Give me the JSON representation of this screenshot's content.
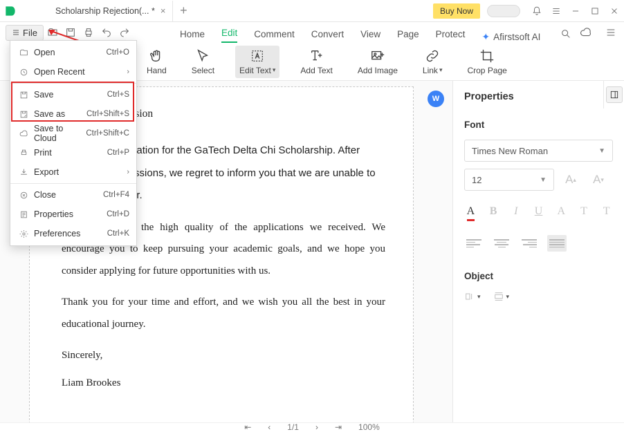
{
  "titlebar": {
    "tab_title": "Scholarship Rejection(... *",
    "buy_now": "Buy Now"
  },
  "file_chip": "File",
  "menu_tabs": [
    "Home",
    "Edit",
    "Comment",
    "Convert",
    "View",
    "Page",
    "Protect"
  ],
  "menu_tabs_active_index": 1,
  "ai_label": "Afirstsoft AI",
  "ribbon": {
    "hand": "Hand",
    "select": "Select",
    "edit_text": "Edit Text",
    "add_text": "Add Text",
    "add_image": "Add Image",
    "link": "Link",
    "crop_page": "Crop Page"
  },
  "file_menu": {
    "open": {
      "label": "Open",
      "shortcut": "Ctrl+O"
    },
    "open_recent": {
      "label": "Open Recent"
    },
    "save": {
      "label": "Save",
      "shortcut": "Ctrl+S"
    },
    "save_as": {
      "label": "Save as",
      "shortcut": "Ctrl+Shift+S"
    },
    "save_cloud": {
      "label": "Save to Cloud",
      "shortcut": "Ctrl+Shift+C"
    },
    "print": {
      "label": "Print",
      "shortcut": "Ctrl+P"
    },
    "export": {
      "label": "Export"
    },
    "close": {
      "label": "Close",
      "shortcut": "Ctrl+F4"
    },
    "properties": {
      "label": "Properties",
      "shortcut": "Ctrl+D"
    },
    "preferences": {
      "label": "Preferences",
      "shortcut": "Ctrl+K"
    }
  },
  "document": {
    "heading": "Application Decision",
    "p1": "ciate your application for the GaTech Delta Chi Scholarship. After",
    "p2": "tstanding  submissions, we regret to inform you that we are  unable to",
    "p3": "olarship  this year.",
    "p4": "not easy due to the high quality of the applications we received. We encourage you to keep pursuing your academic goals, and we hope you consider applying for future opportunities with us.",
    "p5": "Thank you for your time and effort, and we wish you all the best in your educational journey.",
    "p6": "Sincerely,",
    "p7": "Liam Brookes"
  },
  "properties_panel": {
    "title": "Properties",
    "font_label": "Font",
    "font_family": "Times New Roman",
    "font_size": "12",
    "object_label": "Object"
  },
  "status": {
    "page": "1/1",
    "zoom": "100%"
  }
}
